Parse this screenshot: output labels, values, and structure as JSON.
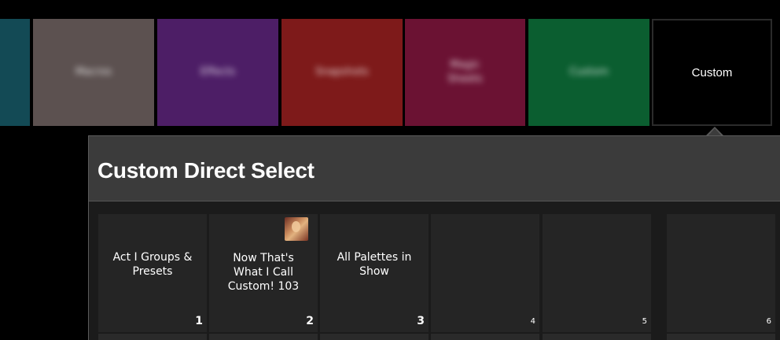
{
  "tabs": [
    {
      "label": "",
      "color": "#134a55"
    },
    {
      "label": "Macros",
      "color": "#5c5150"
    },
    {
      "label": "Effects",
      "color": "#4d1e66"
    },
    {
      "label": "Snapshots",
      "color": "#7e1a1a"
    },
    {
      "label": "Magic\nSheets",
      "color": "#6b1233"
    },
    {
      "label": "Custom",
      "color": "#0b5e30"
    },
    {
      "label": "Custom",
      "color": "#000000"
    }
  ],
  "panel": {
    "title": "Custom Direct Select",
    "header_color": "#3b3b3b"
  },
  "tiles": [
    {
      "label": "Act I Groups &\nPresets",
      "number": "1",
      "has_thumb": false
    },
    {
      "label": "Now That's\nWhat I Call\nCustom! 103",
      "number": "2",
      "has_thumb": true,
      "thumb_icon": "portrait-thumbnail-icon"
    },
    {
      "label": "All Palettes in\nShow",
      "number": "3",
      "has_thumb": false
    },
    {
      "label": "",
      "number": "4",
      "has_thumb": false
    },
    {
      "label": "",
      "number": "5",
      "has_thumb": false
    },
    {
      "label": "",
      "number": "6",
      "has_thumb": false
    }
  ]
}
